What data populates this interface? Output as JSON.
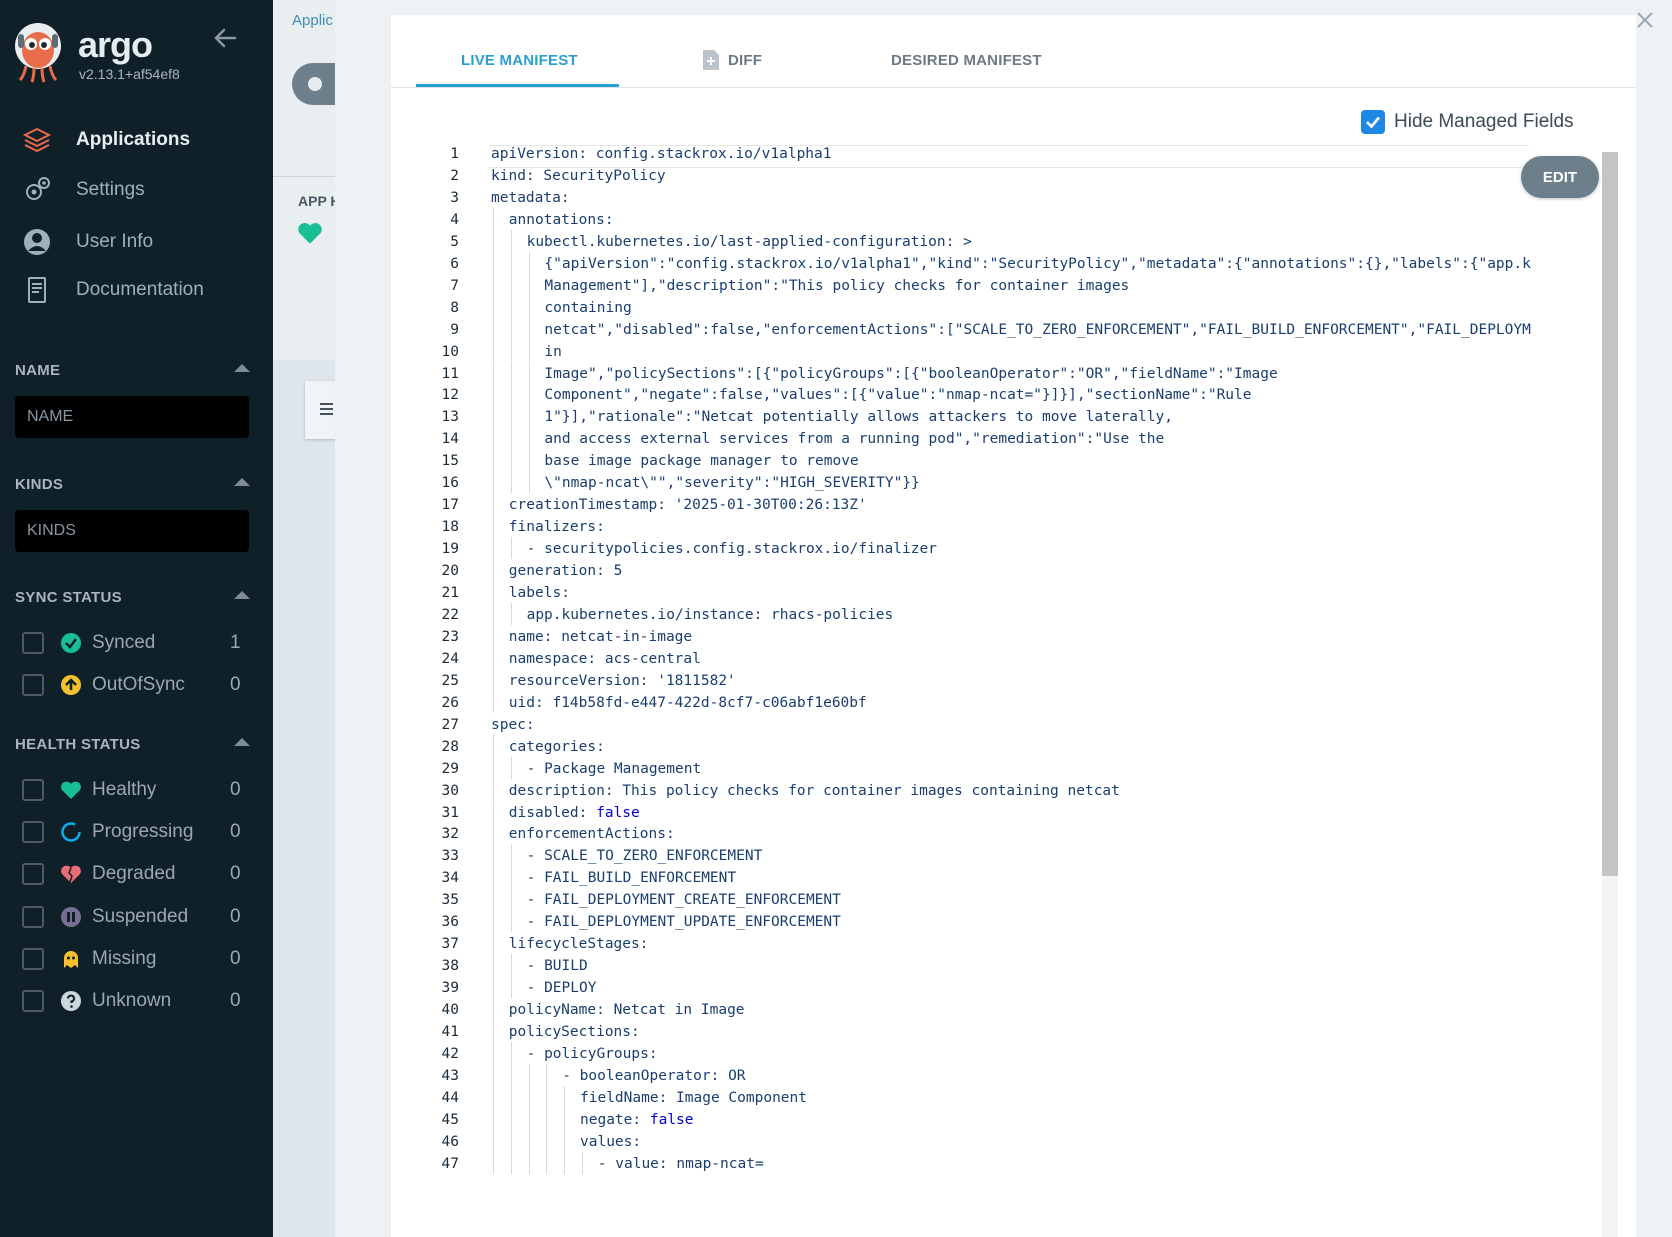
{
  "sidebar": {
    "brand": "argo",
    "version": "v2.13.1+af54ef8",
    "nav": [
      {
        "label": "Applications",
        "icon": "layers-icon"
      },
      {
        "label": "Settings",
        "icon": "gears-icon"
      },
      {
        "label": "User Info",
        "icon": "user-circle-icon"
      },
      {
        "label": "Documentation",
        "icon": "document-icon"
      }
    ],
    "filters": {
      "name": {
        "title": "NAME",
        "placeholder": "NAME"
      },
      "kinds": {
        "title": "KINDS",
        "placeholder": "KINDS"
      },
      "sync_status": {
        "title": "SYNC STATUS",
        "items": [
          {
            "label": "Synced",
            "count": "1",
            "icon": "check-circle-icon",
            "color": "#18be94"
          },
          {
            "label": "OutOfSync",
            "count": "0",
            "icon": "arrow-up-circle-icon",
            "color": "#f4c030"
          }
        ]
      },
      "health_status": {
        "title": "HEALTH STATUS",
        "items": [
          {
            "label": "Healthy",
            "count": "0",
            "icon": "heart-icon",
            "color": "#18be94"
          },
          {
            "label": "Progressing",
            "count": "0",
            "icon": "spinner-icon",
            "color": "#0dadea"
          },
          {
            "label": "Degraded",
            "count": "0",
            "icon": "broken-heart-icon",
            "color": "#e96d76"
          },
          {
            "label": "Suspended",
            "count": "0",
            "icon": "pause-circle-icon",
            "color": "#766f94"
          },
          {
            "label": "Missing",
            "count": "0",
            "icon": "ghost-icon",
            "color": "#f4c030"
          },
          {
            "label": "Unknown",
            "count": "0",
            "icon": "question-circle-icon",
            "color": "#ccd6dd"
          }
        ]
      }
    }
  },
  "background": {
    "breadcrumb": "Applic",
    "app_header": "APP H"
  },
  "panel": {
    "tabs": [
      {
        "label": "LIVE MANIFEST",
        "active": true
      },
      {
        "label": "DIFF",
        "active": false
      },
      {
        "label": "DESIRED MANIFEST",
        "active": false
      }
    ],
    "hide_managed_fields": {
      "label": "Hide Managed Fields",
      "checked": true
    },
    "edit_button": "EDIT"
  },
  "manifest": {
    "lines": [
      [
        0,
        [
          [
            "k",
            "apiVersion"
          ],
          [
            "p",
            ": "
          ],
          [
            "v",
            "config.stackrox.io/v1alpha1"
          ]
        ]
      ],
      [
        0,
        [
          [
            "k",
            "kind"
          ],
          [
            "p",
            ": "
          ],
          [
            "v",
            "SecurityPolicy"
          ]
        ]
      ],
      [
        0,
        [
          [
            "k",
            "metadata"
          ],
          [
            "p",
            ":"
          ]
        ]
      ],
      [
        1,
        [
          [
            "k",
            "annotations"
          ],
          [
            "p",
            ":"
          ]
        ]
      ],
      [
        2,
        [
          [
            "k",
            "kubectl.kubernetes.io/last-applied-configuration"
          ],
          [
            "p",
            ": >"
          ]
        ]
      ],
      [
        3,
        [
          [
            "v",
            "{\"apiVersion\":\"config.stackrox.io/v1alpha1\",\"kind\":\"SecurityPolicy\",\"metadata\":{\"annotations\":{},\"labels\":{\"app.k"
          ]
        ]
      ],
      [
        3,
        [
          [
            "v",
            "Management\"],\"description\":\"This policy checks for container images"
          ]
        ]
      ],
      [
        3,
        [
          [
            "v",
            "containing"
          ]
        ]
      ],
      [
        3,
        [
          [
            "v",
            "netcat\",\"disabled\":false,\"enforcementActions\":[\"SCALE_TO_ZERO_ENFORCEMENT\",\"FAIL_BUILD_ENFORCEMENT\",\"FAIL_DEPLOYM"
          ]
        ]
      ],
      [
        3,
        [
          [
            "v",
            "in"
          ]
        ]
      ],
      [
        3,
        [
          [
            "v",
            "Image\",\"policySections\":[{\"policyGroups\":[{\"booleanOperator\":\"OR\",\"fieldName\":\"Image"
          ]
        ]
      ],
      [
        3,
        [
          [
            "v",
            "Component\",\"negate\":false,\"values\":[{\"value\":\"nmap-ncat=\"}]}],\"sectionName\":\"Rule"
          ]
        ]
      ],
      [
        3,
        [
          [
            "v",
            "1\"}],\"rationale\":\"Netcat potentially allows attackers to move laterally,"
          ]
        ]
      ],
      [
        3,
        [
          [
            "v",
            "and access external services from a running pod\",\"remediation\":\"Use the"
          ]
        ]
      ],
      [
        3,
        [
          [
            "v",
            "base image package manager to remove"
          ]
        ]
      ],
      [
        3,
        [
          [
            "v",
            "\\\"nmap-ncat\\\"\",\"severity\":\"HIGH_SEVERITY\"}}"
          ]
        ]
      ],
      [
        1,
        [
          [
            "k",
            "creationTimestamp"
          ],
          [
            "p",
            ": "
          ],
          [
            "v",
            "'2025-01-30T00:26:13Z'"
          ]
        ]
      ],
      [
        1,
        [
          [
            "k",
            "finalizers"
          ],
          [
            "p",
            ":"
          ]
        ]
      ],
      [
        2,
        [
          [
            "p",
            "- "
          ],
          [
            "v",
            "securitypolicies.config.stackrox.io/finalizer"
          ]
        ]
      ],
      [
        1,
        [
          [
            "k",
            "generation"
          ],
          [
            "p",
            ": "
          ],
          [
            "v",
            "5"
          ]
        ]
      ],
      [
        1,
        [
          [
            "k",
            "labels"
          ],
          [
            "p",
            ":"
          ]
        ]
      ],
      [
        2,
        [
          [
            "k",
            "app.kubernetes.io/instance"
          ],
          [
            "p",
            ": "
          ],
          [
            "v",
            "rhacs-policies"
          ]
        ]
      ],
      [
        1,
        [
          [
            "k",
            "name"
          ],
          [
            "p",
            ": "
          ],
          [
            "v",
            "netcat-in-image"
          ]
        ]
      ],
      [
        1,
        [
          [
            "k",
            "namespace"
          ],
          [
            "p",
            ": "
          ],
          [
            "v",
            "acs-central"
          ]
        ]
      ],
      [
        1,
        [
          [
            "k",
            "resourceVersion"
          ],
          [
            "p",
            ": "
          ],
          [
            "v",
            "'1811582'"
          ]
        ]
      ],
      [
        1,
        [
          [
            "k",
            "uid"
          ],
          [
            "p",
            ": "
          ],
          [
            "v",
            "f14b58fd-e447-422d-8cf7-c06abf1e60bf"
          ]
        ]
      ],
      [
        0,
        [
          [
            "k",
            "spec"
          ],
          [
            "p",
            ":"
          ]
        ]
      ],
      [
        1,
        [
          [
            "k",
            "categories"
          ],
          [
            "p",
            ":"
          ]
        ]
      ],
      [
        2,
        [
          [
            "p",
            "- "
          ],
          [
            "v",
            "Package Management"
          ]
        ]
      ],
      [
        1,
        [
          [
            "k",
            "description"
          ],
          [
            "p",
            ": "
          ],
          [
            "v",
            "This policy checks for container images containing netcat"
          ]
        ]
      ],
      [
        1,
        [
          [
            "k",
            "disabled"
          ],
          [
            "p",
            ": "
          ],
          [
            "b",
            "false"
          ]
        ]
      ],
      [
        1,
        [
          [
            "k",
            "enforcementActions"
          ],
          [
            "p",
            ":"
          ]
        ]
      ],
      [
        2,
        [
          [
            "p",
            "- "
          ],
          [
            "v",
            "SCALE_TO_ZERO_ENFORCEMENT"
          ]
        ]
      ],
      [
        2,
        [
          [
            "p",
            "- "
          ],
          [
            "v",
            "FAIL_BUILD_ENFORCEMENT"
          ]
        ]
      ],
      [
        2,
        [
          [
            "p",
            "- "
          ],
          [
            "v",
            "FAIL_DEPLOYMENT_CREATE_ENFORCEMENT"
          ]
        ]
      ],
      [
        2,
        [
          [
            "p",
            "- "
          ],
          [
            "v",
            "FAIL_DEPLOYMENT_UPDATE_ENFORCEMENT"
          ]
        ]
      ],
      [
        1,
        [
          [
            "k",
            "lifecycleStages"
          ],
          [
            "p",
            ":"
          ]
        ]
      ],
      [
        2,
        [
          [
            "p",
            "- "
          ],
          [
            "v",
            "BUILD"
          ]
        ]
      ],
      [
        2,
        [
          [
            "p",
            "- "
          ],
          [
            "v",
            "DEPLOY"
          ]
        ]
      ],
      [
        1,
        [
          [
            "k",
            "policyName"
          ],
          [
            "p",
            ": "
          ],
          [
            "v",
            "Netcat in Image"
          ]
        ]
      ],
      [
        1,
        [
          [
            "k",
            "policySections"
          ],
          [
            "p",
            ":"
          ]
        ]
      ],
      [
        2,
        [
          [
            "p",
            "- "
          ],
          [
            "k",
            "policyGroups"
          ],
          [
            "p",
            ":"
          ]
        ]
      ],
      [
        4,
        [
          [
            "p",
            "- "
          ],
          [
            "k",
            "booleanOperator"
          ],
          [
            "p",
            ": "
          ],
          [
            "v",
            "OR"
          ]
        ]
      ],
      [
        5,
        [
          [
            "k",
            "fieldName"
          ],
          [
            "p",
            ": "
          ],
          [
            "v",
            "Image Component"
          ]
        ]
      ],
      [
        5,
        [
          [
            "k",
            "negate"
          ],
          [
            "p",
            ": "
          ],
          [
            "b",
            "false"
          ]
        ]
      ],
      [
        5,
        [
          [
            "k",
            "values"
          ],
          [
            "p",
            ":"
          ]
        ]
      ],
      [
        6,
        [
          [
            "p",
            "- "
          ],
          [
            "k",
            "value"
          ],
          [
            "p",
            ": "
          ],
          [
            "v",
            "nmap-ncat="
          ]
        ]
      ]
    ]
  }
}
